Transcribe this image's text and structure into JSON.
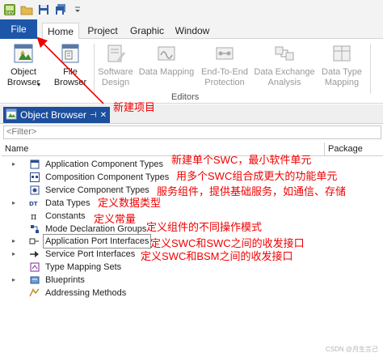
{
  "quick_access": {
    "items": [
      {
        "icon": "app-logo-icon"
      },
      {
        "icon": "open-folder-icon"
      },
      {
        "icon": "save-icon"
      },
      {
        "icon": "save-all-icon"
      },
      {
        "icon": "customize-dropdown-icon"
      }
    ]
  },
  "tabs": {
    "file": "File",
    "home": "Home",
    "project": "Project",
    "graphic": "Graphic",
    "window": "Window"
  },
  "ribbon": {
    "object_browser": "Object\nBrowser",
    "object_browser_arrow": "▾",
    "file_browser": "File\nBrowser",
    "software_design": "Software\nDesign",
    "data_mapping": "Data Mapping",
    "end_to_end": "End-To-End\nProtection",
    "data_exchange": "Data Exchange\nAnalysis",
    "data_type_mapping": "Data Type\nMapping",
    "group_editors": "Editors"
  },
  "panel": {
    "title": "Object Browser",
    "pin": "⊣",
    "close": "✕",
    "filter_placeholder": "<Filter>",
    "col_name": "Name",
    "col_package": "Package"
  },
  "tree": [
    {
      "label": "Application Component Types",
      "icon": "app-component-icon",
      "expandable": true
    },
    {
      "label": "Composition Component Types",
      "icon": "composition-icon",
      "expandable": false
    },
    {
      "label": "Service Component Types",
      "icon": "service-component-icon",
      "expandable": false
    },
    {
      "label": "Data Types",
      "icon": "data-types-icon",
      "expandable": true
    },
    {
      "label": "Constants",
      "icon": "pi-constant-icon",
      "expandable": false
    },
    {
      "label": "Mode Declaration Groups",
      "icon": "mode-group-icon",
      "expandable": false
    },
    {
      "label": "Application Port Interfaces",
      "icon": "port-interface-icon",
      "expandable": true,
      "selected": true
    },
    {
      "label": "Service Port Interfaces",
      "icon": "service-port-icon",
      "expandable": true
    },
    {
      "label": "Type Mapping Sets",
      "icon": "type-mapping-icon",
      "expandable": false
    },
    {
      "label": "Blueprints",
      "icon": "blueprint-icon",
      "expandable": true
    },
    {
      "label": "Addressing Methods",
      "icon": "addressing-icon",
      "expandable": false
    }
  ],
  "annotations": {
    "new_project": "新建项目",
    "swc": "新建单个SWC，最小软件单元",
    "composition": "用多个SWC组合成更大的功能单元",
    "service": "服务组件，提供基础服务，如通信、存储",
    "data_types": "定义数据类型",
    "constants": "定义常量",
    "modes": "定义组件的不同操作模式",
    "app_ports": "定义SWC和SWC之间的收发接口",
    "service_ports": "定义SWC和BSM之间的收发接口"
  },
  "watermark": "CSDN @月生言己",
  "colors": {
    "file_tab": "#1c56a8",
    "panel_tab": "#1c4f9c",
    "annotation": "#f00000"
  }
}
